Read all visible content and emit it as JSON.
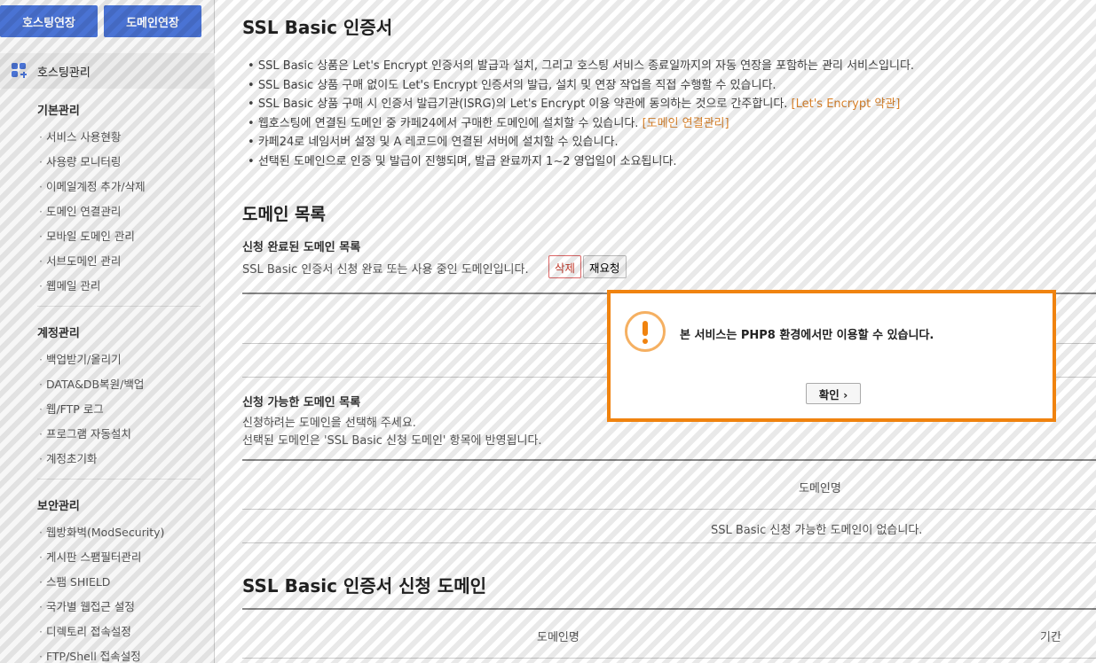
{
  "sidebar": {
    "top_buttons": {
      "hosting": "호스팅연장",
      "domain": "도메인연장"
    },
    "section": "호스팅관리",
    "groups": [
      {
        "title": "기본관리",
        "items": [
          "서비스 사용현황",
          "사용량 모니터링",
          "이메일계정 추가/삭제",
          "도메인 연결관리",
          "모바일 도메인 관리",
          "서브도메인 관리",
          "웹메일 관리"
        ]
      },
      {
        "title": "계정관리",
        "items": [
          "백업받기/올리기",
          "DATA&DB복원/백업",
          "웹/FTP 로그",
          "프로그램 자동설치",
          "계정초기화"
        ]
      },
      {
        "title": "보안관리",
        "items": [
          "웹방화벽(ModSecurity)",
          "게시판 스팸필터관리",
          "스팸 SHIELD",
          "국가별 웹접근 설정",
          "디렉토리 접속설정",
          "FTP/Shell 접속설정"
        ]
      }
    ]
  },
  "main": {
    "title": "SSL Basic 인증서",
    "notices": [
      {
        "text": "SSL Basic 상품은 Let's Encrypt 인증서의 발급과 설치, 그리고 호스팅 서비스 종료일까지의 자동 연장을 포함하는 관리 서비스입니다.",
        "link": ""
      },
      {
        "text": "SSL Basic 상품 구매 없이도 Let's Encrypt 인증서의 발급, 설치 및 연장 작업을 직접 수행할 수 있습니다.",
        "link": ""
      },
      {
        "text": "SSL Basic 상품 구매 시 인증서 발급기관(ISRG)의 Let's Encrypt 이용 약관에 동의하는 것으로 간주합니다. ",
        "link": "[Let's Encrypt 약관]"
      },
      {
        "text": "웹호스팅에 연결된 도메인 중 카페24에서 구매한 도메인에 설치할 수 있습니다. ",
        "link": "[도메인 연결관리]"
      },
      {
        "text": "카페24로 네임서버 설정 및 A 레코드에 연결된 서버에 설치할 수 있습니다.",
        "link": ""
      },
      {
        "text": "선택된 도메인으로 인증 및 발급이 진행되며, 발급 완료까지 1~2 영업일이 소요됩니다.",
        "link": ""
      }
    ],
    "domain_list": {
      "title": "도메인 목록",
      "completed_title": "신청 완료된 도메인 목록",
      "completed_desc": "SSL Basic 인증서 신청 완료 또는 사용 중인 도메인입니다.",
      "delete_label": "삭제",
      "reapply_label": "재요청",
      "available_title": "신청 가능한 도메인 목록",
      "available_desc1": "신청하려는 도메인을 선택해 주세요.",
      "available_desc2": "선택된 도메인은 'SSL Basic 신청 도메인' 항목에 반영됩니다.",
      "col_domain": "도메인명",
      "empty_msg": "SSL Basic 신청 가능한 도메인이 없습니다."
    },
    "apply_section": {
      "title": "SSL Basic 인증서 신청 도메인",
      "col_domain": "도메인명",
      "col_period": "기간"
    }
  },
  "modal": {
    "message": "본 서비스는 PHP8 환경에서만 이용할 수 있습니다.",
    "ok_label": "확인 ›",
    "accent_color": "#f0830f"
  }
}
